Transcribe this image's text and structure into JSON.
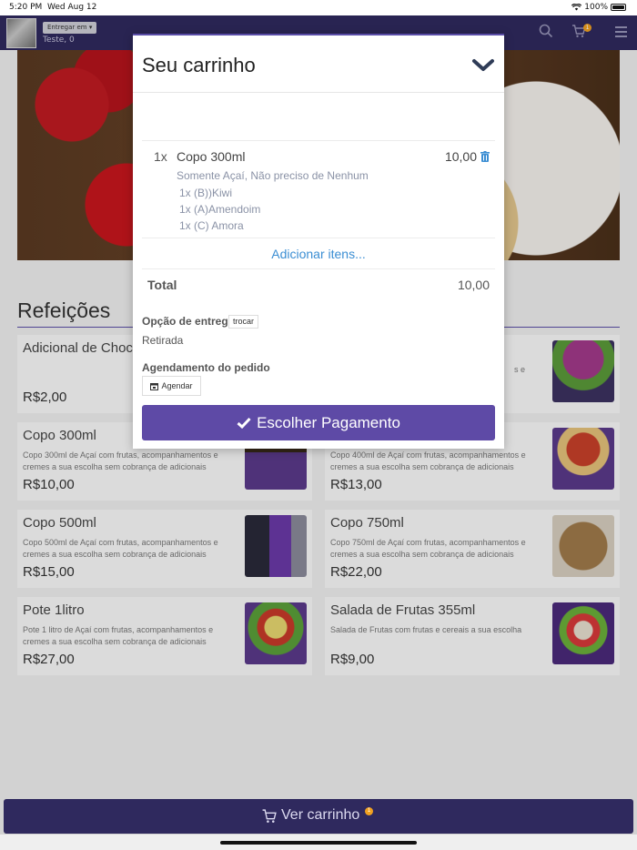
{
  "status_bar": {
    "time": "5:20 PM",
    "date": "Wed Aug 12",
    "battery": "100%"
  },
  "header": {
    "deliver_label": "Entregar em",
    "user_line": "Teste, 0",
    "cart_count": "1"
  },
  "section_title": "Refeições",
  "products": [
    {
      "name": "Adicional de Choc",
      "desc": "",
      "price": "R$2,00"
    },
    {
      "name": "",
      "desc": "s e",
      "price": ""
    },
    {
      "name": "Copo 300ml",
      "desc": "Copo 300ml de Açaí com frutas, acompanhamentos e cremes a sua escolha sem cobrança de adicionais",
      "price": "R$10,00"
    },
    {
      "name": "",
      "desc": "Copo 400ml de Açaí com frutas, acompanhamentos e cremes a sua escolha sem cobrança de adicionais",
      "price": "R$13,00"
    },
    {
      "name": "Copo 500ml",
      "desc": "Copo 500ml de Açaí com frutas, acompanhamentos e cremes a sua escolha sem cobrança de adicionais",
      "price": "R$15,00"
    },
    {
      "name": "Copo 750ml",
      "desc": "Copo 750ml de Açaí com frutas, acompanhamentos e cremes a sua escolha sem cobrança de adicionais",
      "price": "R$22,00"
    },
    {
      "name": "Pote 1litro",
      "desc": "Pote 1 litro de Açaí com frutas, acompanhamentos e cremes a sua escolha sem cobrança de adicionais",
      "price": "R$27,00"
    },
    {
      "name": "Salada de Frutas 355ml",
      "desc": "Salada de Frutas com frutas e cereais a sua escolha",
      "price": "R$9,00"
    }
  ],
  "bottom_bar": {
    "label": "Ver carrinho",
    "count": "1"
  },
  "cart_modal": {
    "title": "Seu carrinho",
    "item": {
      "qty": "1x",
      "name": "Copo 300ml",
      "price": "10,00",
      "details": [
        "Somente Açaí, Não preciso de Nenhum",
        "1x (B))Kiwi",
        "1x (A)Amendoim",
        "1x (C) Amora"
      ]
    },
    "add_items": "Adicionar itens...",
    "total_label": "Total",
    "total_value": "10,00",
    "delivery_option_label": "Opção de entrega",
    "change_button": "trocar",
    "delivery_value": "Retirada",
    "schedule_label": "Agendamento do pedido",
    "schedule_button": "Agendar",
    "pay_button": "Escolher Pagamento"
  },
  "colors": {
    "header_bg": "#2f295e",
    "accent": "#5e4aa6",
    "link": "#3b8ed3",
    "badge": "#f0a020"
  }
}
